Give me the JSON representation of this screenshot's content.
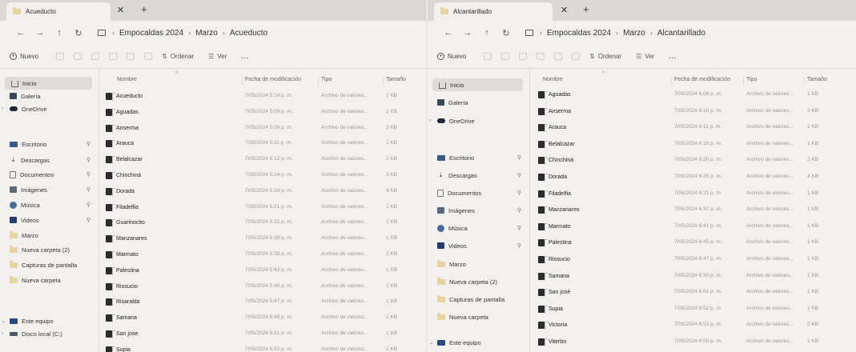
{
  "windows": [
    {
      "tab_title": "Acueducto",
      "breadcrumb": [
        "Empocaldas 2024",
        "Marzo",
        "Acueducto"
      ],
      "toolbar": {
        "new_label": "Nuevo",
        "sort_label": "Ordenar",
        "view_label": "Ver",
        "more_label": "..."
      },
      "sidebar": [
        {
          "label": "Inicio",
          "icon": "home-icon",
          "selected": true
        },
        {
          "label": "Galería",
          "icon": "gallery-icon"
        },
        {
          "label": "OneDrive",
          "icon": "cloud-icon",
          "expandable": true
        },
        {
          "label": "Escritorio",
          "icon": "desktop-icon",
          "pinned": true
        },
        {
          "label": "Descargas",
          "icon": "download-icon",
          "pinned": true
        },
        {
          "label": "Documentos",
          "icon": "docs-icon",
          "pinned": true
        },
        {
          "label": "Imágenes",
          "icon": "images-icon",
          "pinned": true
        },
        {
          "label": "Música",
          "icon": "music-icon",
          "pinned": true
        },
        {
          "label": "Videos",
          "icon": "video-icon",
          "pinned": true
        },
        {
          "label": "Marzo",
          "icon": "folder-icon"
        },
        {
          "label": "Nueva carpeta (2)",
          "icon": "folder-icon"
        },
        {
          "label": "Capturas de pantalla",
          "icon": "folder-icon"
        },
        {
          "label": "Nueva carpeta",
          "icon": "folder-icon"
        },
        {
          "label": "Este equipo",
          "icon": "pc-icon",
          "expanded": true
        },
        {
          "label": "Disco local (C:)",
          "icon": "drive-icon",
          "expandable": true
        }
      ],
      "columns": {
        "name": "Nombre",
        "date": "Fecha de modificación",
        "type": "Tipo",
        "size": "Tamaño"
      },
      "files": [
        {
          "name": "Acueducto",
          "date": "7/05/2024 5:14 p. m.",
          "type": "Archivo de valores...",
          "size": "1 KB"
        },
        {
          "name": "Aguadas",
          "date": "7/05/2024 5:09 p. m.",
          "type": "Archivo de valores...",
          "size": "1 KB"
        },
        {
          "name": "Anserma",
          "date": "7/05/2024 5:09 p. m.",
          "type": "Archivo de valores...",
          "size": "3 KB"
        },
        {
          "name": "Arauca",
          "date": "7/05/2024 5:11 p. m.",
          "type": "Archivo de valores...",
          "size": "1 KB"
        },
        {
          "name": "Belalcazar",
          "date": "7/05/2024 5:12 p. m.",
          "type": "Archivo de valores...",
          "size": "1 KB"
        },
        {
          "name": "Chinchiná",
          "date": "7/05/2024 5:14 p. m.",
          "type": "Archivo de valores...",
          "size": "3 KB"
        },
        {
          "name": "Dorada",
          "date": "7/05/2024 5:24 p. m.",
          "type": "Archivo de valores...",
          "size": "4 KB"
        },
        {
          "name": "Filadelfia",
          "date": "7/05/2024 5:21 p. m.",
          "type": "Archivo de valores...",
          "size": "1 KB"
        },
        {
          "name": "Guarinocito",
          "date": "7/05/2024 5:22 p. m.",
          "type": "Archivo de valores...",
          "size": "1 KB"
        },
        {
          "name": "Manzanares",
          "date": "7/05/2024 5:39 p. m.",
          "type": "Archivo de valores...",
          "size": "1 KB"
        },
        {
          "name": "Marmato",
          "date": "7/05/2024 5:39 p. m.",
          "type": "Archivo de valores...",
          "size": "2 KB"
        },
        {
          "name": "Palestina",
          "date": "7/05/2024 5:42 p. m.",
          "type": "Archivo de valores...",
          "size": "1 KB"
        },
        {
          "name": "Riosucio",
          "date": "7/05/2024 5:48 p. m.",
          "type": "Archivo de valores...",
          "size": "1 KB"
        },
        {
          "name": "Risaralda",
          "date": "7/05/2024 5:47 p. m.",
          "type": "Archivo de valores...",
          "size": "1 KB"
        },
        {
          "name": "Samana",
          "date": "7/05/2024 5:49 p. m.",
          "type": "Archivo de valores...",
          "size": "1 KB"
        },
        {
          "name": "San jose",
          "date": "7/05/2024 5:51 p. m.",
          "type": "Archivo de valores...",
          "size": "1 KB"
        },
        {
          "name": "Supia",
          "date": "7/05/2024 5:52 p. m.",
          "type": "Archivo de valores...",
          "size": "1 KB"
        }
      ]
    },
    {
      "tab_title": "Alcantarillado",
      "breadcrumb": [
        "Empocaldas 2024",
        "Marzo",
        "Alcantarillado"
      ],
      "toolbar": {
        "new_label": "Nuevo",
        "sort_label": "Ordenar",
        "view_label": "Ver",
        "more_label": "..."
      },
      "sidebar": [
        {
          "label": "Inicio",
          "icon": "home-icon",
          "selected": true
        },
        {
          "label": "Galería",
          "icon": "gallery-icon"
        },
        {
          "label": "OneDrive",
          "icon": "cloud-icon",
          "expandable": true
        },
        {
          "label": "Escritorio",
          "icon": "desktop-icon",
          "pinned": true
        },
        {
          "label": "Descargas",
          "icon": "download-icon",
          "pinned": true
        },
        {
          "label": "Documentos",
          "icon": "docs-icon",
          "pinned": true
        },
        {
          "label": "Imágenes",
          "icon": "images-icon",
          "pinned": true
        },
        {
          "label": "Música",
          "icon": "music-icon",
          "pinned": true
        },
        {
          "label": "Videos",
          "icon": "video-icon",
          "pinned": true
        },
        {
          "label": "Marzo",
          "icon": "folder-icon"
        },
        {
          "label": "Nueva carpeta (2)",
          "icon": "folder-icon"
        },
        {
          "label": "Capturas de pantalla",
          "icon": "folder-icon"
        },
        {
          "label": "Nueva carpeta",
          "icon": "folder-icon"
        },
        {
          "label": "Este equipo",
          "icon": "pc-icon",
          "expanded": true
        }
      ],
      "columns": {
        "name": "Nombre",
        "date": "Fecha de modificación",
        "type": "Tipo",
        "size": "Tamaño"
      },
      "files": [
        {
          "name": "Aguadas",
          "date": "7/05/2024 6:09 p. m.",
          "type": "Archivo de valores...",
          "size": "1 KB"
        },
        {
          "name": "Anserma",
          "date": "7/05/2024 6:10 p. m.",
          "type": "Archivo de valores...",
          "size": "2 KB"
        },
        {
          "name": "Arauca",
          "date": "7/05/2024 6:11 p. m.",
          "type": "Archivo de valores...",
          "size": "1 KB"
        },
        {
          "name": "Belalcazar",
          "date": "7/05/2024 6:16 p. m.",
          "type": "Archivo de valores...",
          "size": "1 KB"
        },
        {
          "name": "Chinchiná",
          "date": "7/05/2024 6:20 p. m.",
          "type": "Archivo de valores...",
          "size": "2 KB"
        },
        {
          "name": "Dorada",
          "date": "7/05/2024 6:25 p. m.",
          "type": "Archivo de valores...",
          "size": "4 KB"
        },
        {
          "name": "Filadelfia",
          "date": "7/05/2024 6:21 p. m.",
          "type": "Archivo de valores...",
          "size": "1 KB"
        },
        {
          "name": "Manzanares",
          "date": "7/05/2024 6:37 p. m.",
          "type": "Archivo de valores...",
          "size": "1 KB"
        },
        {
          "name": "Marmato",
          "date": "7/05/2024 6:41 p. m.",
          "type": "Archivo de valores...",
          "size": "1 KB"
        },
        {
          "name": "Palestina",
          "date": "7/05/2024 6:45 p. m.",
          "type": "Archivo de valores...",
          "size": "1 KB"
        },
        {
          "name": "Riosucio",
          "date": "7/05/2024 6:47 p. m.",
          "type": "Archivo de valores...",
          "size": "1 KB"
        },
        {
          "name": "Samana",
          "date": "7/05/2024 6:50 p. m.",
          "type": "Archivo de valores...",
          "size": "1 KB"
        },
        {
          "name": "San josé",
          "date": "7/05/2024 6:51 p. m.",
          "type": "Archivo de valores...",
          "size": "1 KB"
        },
        {
          "name": "Supia",
          "date": "7/05/2024 6:52 p. m.",
          "type": "Archivo de valores...",
          "size": "1 KB"
        },
        {
          "name": "Victoria",
          "date": "7/05/2024 6:53 p. m.",
          "type": "Archivo de valores...",
          "size": "2 KB"
        },
        {
          "name": "Viterbo",
          "date": "7/05/2024 6:55 p. m.",
          "type": "Archivo de valores...",
          "size": "1 KB"
        }
      ]
    }
  ]
}
